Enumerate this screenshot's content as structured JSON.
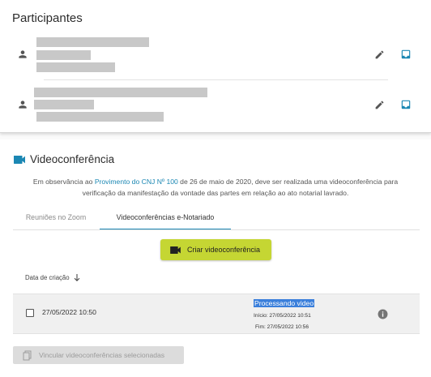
{
  "participants": {
    "title": "Participantes",
    "rows": [
      {
        "icon": "person-icon",
        "actions": [
          "edit-icon",
          "inbox-icon"
        ]
      },
      {
        "icon": "person-icon",
        "actions": [
          "edit-icon",
          "inbox-icon"
        ]
      }
    ]
  },
  "videoconf": {
    "title": "Videoconferência",
    "notice_before": "Em observância ao ",
    "notice_link": "Provimento do CNJ Nº 100",
    "notice_after": " de 26 de maio de 2020, deve ser realizada uma videoconferência para verificação da manifestação da vontade das partes em relação ao ato notarial lavrado.",
    "tabs": [
      {
        "label": "Reuniões no Zoom",
        "active": false
      },
      {
        "label": "Videoconferências e-Notariado",
        "active": true
      }
    ],
    "create_button": "Criar videoconferência",
    "column_header": "Data de criação",
    "rows": [
      {
        "date": "27/05/2022 10:50",
        "status": "Processando video",
        "start": "Início: 27/05/2022 10:51",
        "end": "Fim: 27/05/2022 10:56"
      }
    ],
    "link_button": "Vincular videoconferências selecionadas"
  },
  "colors": {
    "accent": "#1b87b3",
    "create_button_bg": "#c5d633",
    "status_highlight": "#3a7fdb"
  }
}
